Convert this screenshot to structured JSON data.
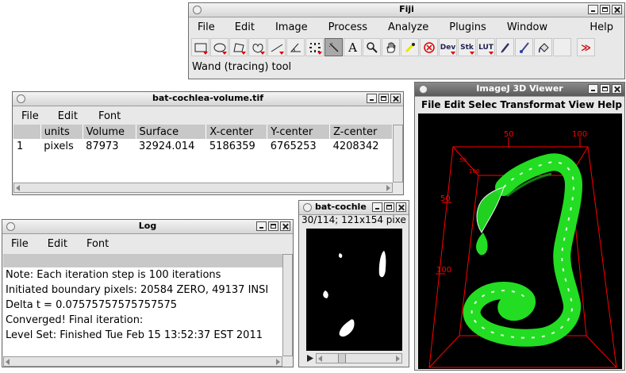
{
  "fiji": {
    "title": "Fiji",
    "menu": [
      "File",
      "Edit",
      "Image",
      "Process",
      "Analyze",
      "Plugins",
      "Window",
      "Help"
    ],
    "tools": [
      "rectangle-icon",
      "oval-icon",
      "polygon-icon",
      "freehand-icon",
      "line-icon",
      "angle-icon",
      "point-icon",
      "wand-icon",
      "text-icon",
      "magnifier-icon",
      "hand-icon",
      "color-picker-icon",
      "stop-icon",
      "dev-icon",
      "stk-icon",
      "lut-icon",
      "pencil-icon",
      "paintbrush-icon",
      "flood-fill-icon",
      "more-tools-icon"
    ],
    "tool_text": {
      "text": "A",
      "dev": "Dev",
      "stk": "Stk",
      "lut": "LUT",
      "more": "≫"
    },
    "status": "Wand (tracing) tool"
  },
  "results": {
    "title": "bat-cochlea-volume.tif",
    "menu": [
      "File",
      "Edit",
      "Font"
    ],
    "columns": [
      "",
      "units",
      "Volume",
      "Surface",
      "X-center",
      "Y-center",
      "Z-center"
    ],
    "row": [
      "1",
      "pixels",
      "87973",
      "32924.014",
      "5186359",
      "6765253",
      "4208342"
    ]
  },
  "log": {
    "title": "Log",
    "menu": [
      "File",
      "Edit",
      "Font"
    ],
    "lines": [
      "Note: Each iteration step is 100 iterations",
      "Initiated boundary pixels: 20584 ZERO, 49137 INSI",
      "Delta t = 0.07575757575757575",
      "Converged! Final iteration:",
      "Level Set: Finished Tue Feb 15 13:52:37 EST 2011"
    ]
  },
  "stack": {
    "title": "bat-cochle",
    "info": "30/114; 121x154 pixe"
  },
  "viewer": {
    "title": "ImageJ 3D Viewer",
    "menu": [
      "File",
      "Edit",
      "Selec",
      "Transformat",
      "View",
      "Help"
    ],
    "axis_labels": {
      "x50": "50",
      "x100": "100",
      "y50": "50",
      "y100": "100",
      "z50": "50",
      "z100": "100"
    },
    "colors": {
      "bbox": "#ff0000",
      "surface": "#22dd22",
      "background": "#000000"
    }
  }
}
